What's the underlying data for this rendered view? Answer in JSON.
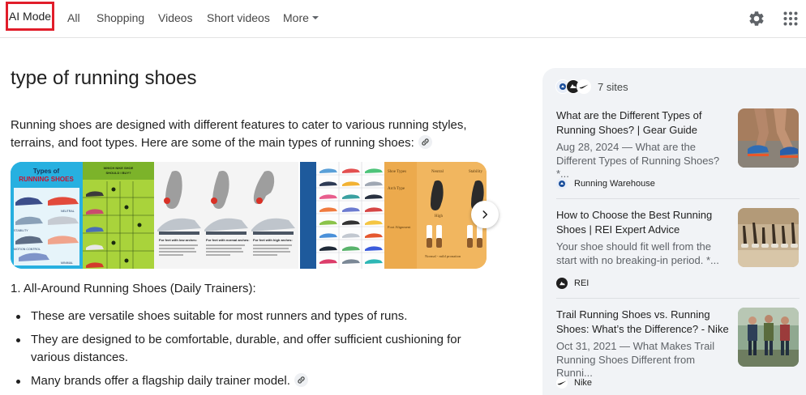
{
  "nav": {
    "ai_mode": "AI Mode",
    "all": "All",
    "shopping": "Shopping",
    "videos": "Videos",
    "short_videos": "Short videos",
    "more": "More"
  },
  "icons": {
    "settings": "gear-icon",
    "apps": "apps-grid-icon",
    "link": "link-icon",
    "next": "chevron-right-icon"
  },
  "accent_colors": {
    "highlight_box": "#e11d2a"
  },
  "query": "type of running shoes",
  "intro": "Running shoes are designed with different features to cater to various running styles, terrains, and foot types. Here are some of the main types of running shoes:",
  "carousel": {
    "image1": {
      "title_line1": "Types of",
      "title_line2": "RUNNING SHOES",
      "labels": [
        "STABILITY",
        "MOTION CONTROL",
        "NEUTRAL",
        "MINIMAL"
      ]
    },
    "image2": {
      "header_line1": "WHICH NIKE SHOE",
      "header_line2": "SHOULD I BUY?"
    },
    "image3": {
      "captions": [
        "For feet with low arches:",
        "For feet with normal arches:",
        "For feet with high arches:"
      ]
    },
    "image5": {
      "col_labels": [
        "Shoe Types",
        "Neutral",
        "Stability"
      ],
      "row_labels": [
        "Arch Type",
        "Foot Alignment"
      ],
      "arch_label": "High",
      "footer": "Normal - mild pronation"
    }
  },
  "section1": {
    "heading": "1. All-Around Running Shoes (Daily Trainers):",
    "bullets": [
      "These are versatile shoes suitable for most runners and types of runs.",
      "They are designed to be comfortable, durable, and offer sufficient cushioning for various distances.",
      "Many brands offer a flagship daily trainer model."
    ]
  },
  "sources": {
    "count_label": "7 sites",
    "cards": [
      {
        "title": "What are the Different Types of Running Shoes? | Gear Guide",
        "snippet": "Aug 28, 2024 — What are the Different Types of Running Shoes? *...",
        "source": "Running Warehouse"
      },
      {
        "title": "How to Choose the Best Running Shoes | REI Expert Advice",
        "snippet": "Your shoe should fit well from the start with no breaking-in period. *...",
        "source": "REI"
      },
      {
        "title": "Trail Running Shoes vs. Running Shoes: What’s the Difference? - Nike",
        "snippet": "Oct 31, 2021 — What Makes Trail Running Shoes Different from Runni...",
        "source": "Nike"
      }
    ]
  }
}
